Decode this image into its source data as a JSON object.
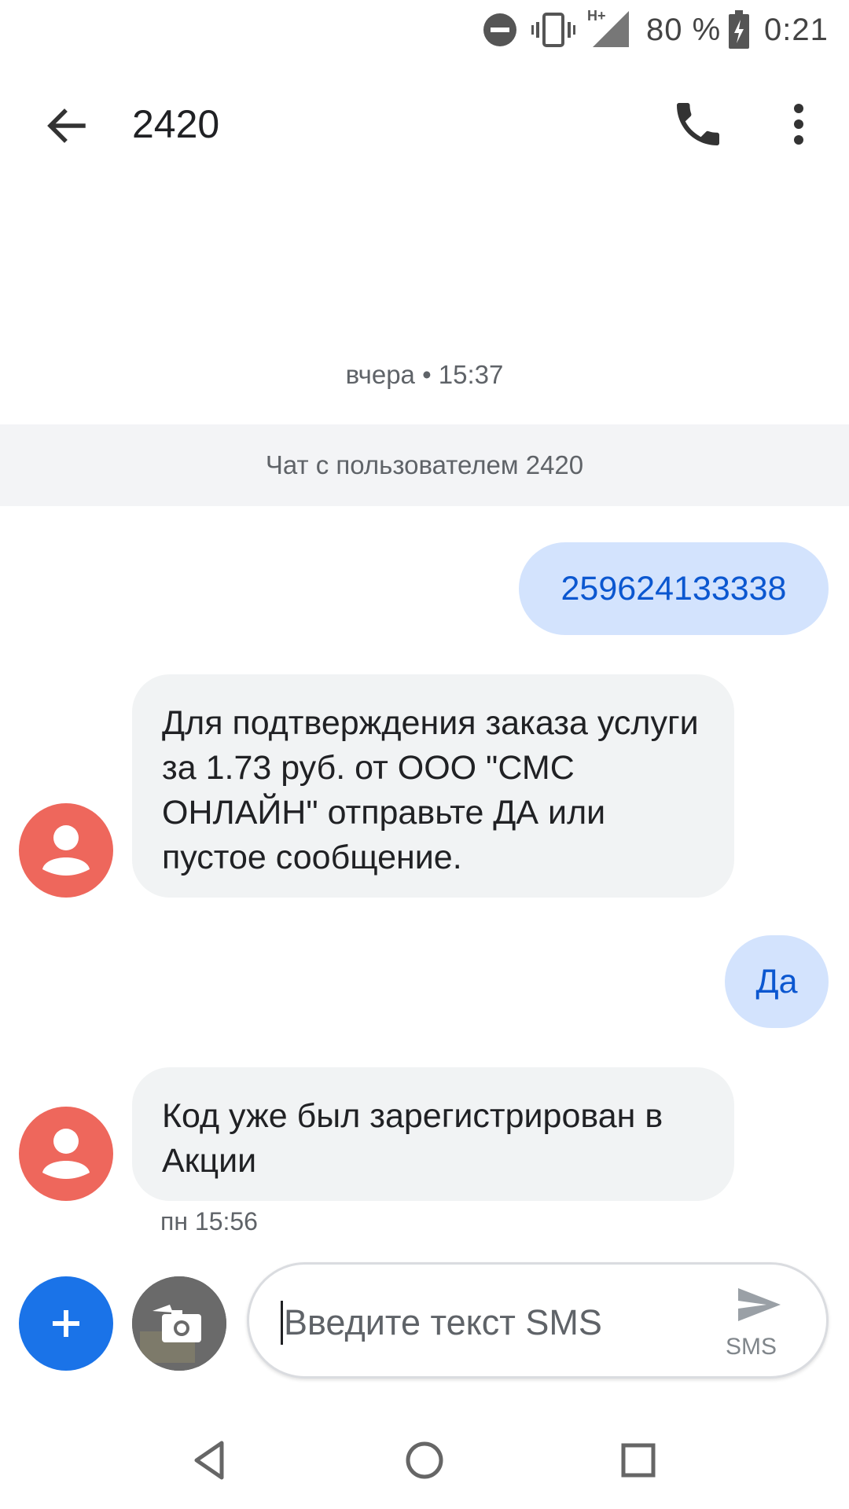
{
  "status_bar": {
    "battery_text": "80 %",
    "time": "0:21",
    "network_type": "H+",
    "icons": [
      "do-not-disturb-icon",
      "vibrate-icon",
      "signal-icon",
      "battery-charging-icon"
    ]
  },
  "app_bar": {
    "title": "2420",
    "icons": [
      "back-arrow-icon",
      "phone-icon",
      "more-vert-icon"
    ]
  },
  "conversation": {
    "date_stamp": "вчера • 15:37",
    "banner": "Чат с пользователем 2420",
    "messages": [
      {
        "direction": "outgoing",
        "text": "259624133338"
      },
      {
        "direction": "incoming",
        "text": "Для подтверждения заказа услуги за 1.73 руб. от ООО \"СМС ОНЛАЙН\" отправьте ДА или пустое сообщение."
      },
      {
        "direction": "outgoing",
        "text": "Да"
      },
      {
        "direction": "incoming",
        "text": "Код уже был зарегистрирован в Акции",
        "time": "пн 15:56"
      }
    ]
  },
  "compose": {
    "placeholder": "Введите текст SMS",
    "send_label": "SMS"
  },
  "nav_bar": {
    "icons": [
      "back-triangle-icon",
      "home-circle-icon",
      "recents-square-icon"
    ]
  },
  "colors": {
    "outgoing_bubble": "#d3e3fd",
    "outgoing_text": "#0b57d0",
    "incoming_bubble": "#f1f3f4",
    "avatar": "#ee675c",
    "fab": "#1a73e8"
  }
}
